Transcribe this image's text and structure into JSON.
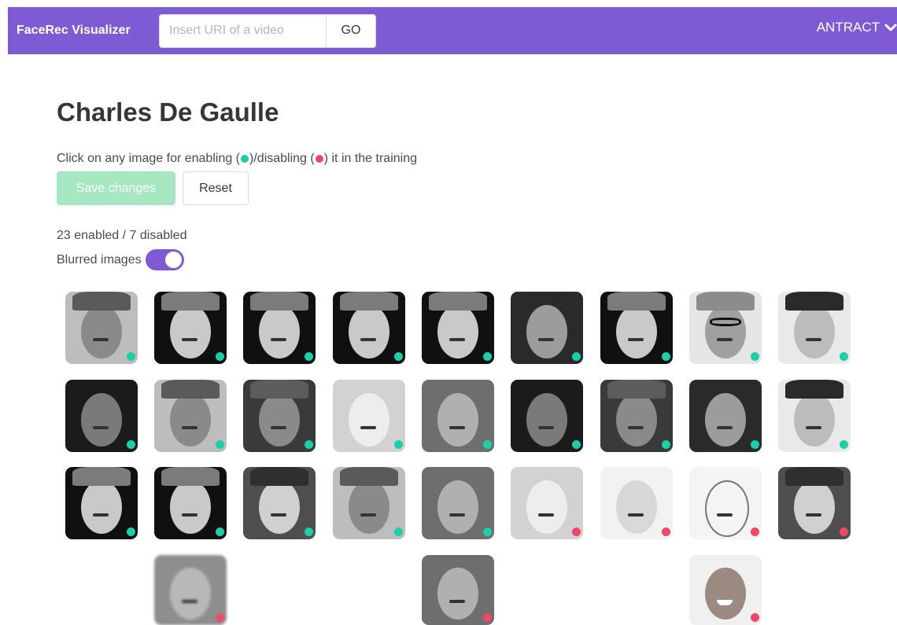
{
  "app": {
    "brand": "FaceRec Visualizer",
    "search_placeholder": "Insert URI of a video",
    "go_label": "GO",
    "user_label": "ANTRACT"
  },
  "page": {
    "title": "Charles De Gaulle",
    "instruction_pre": "Click on any image for enabling (",
    "instruction_mid": ")/disabling (",
    "instruction_post": ") it in the training",
    "save_label": "Save changes",
    "reset_label": "Reset",
    "counts_text": "23 enabled / 7 disabled",
    "blur_label": "Blurred images",
    "blur_enabled": true
  },
  "colors": {
    "accent": "#7e5bd4",
    "enabled": "#1ccfa4",
    "disabled": "#f14668",
    "save_button": "#a6e7c2"
  },
  "faces": [
    {
      "enabled": true,
      "tone": "gray-cap"
    },
    {
      "enabled": true,
      "tone": "dark-kepi"
    },
    {
      "enabled": true,
      "tone": "dark-kepi"
    },
    {
      "enabled": true,
      "tone": "dark-kepi"
    },
    {
      "enabled": true,
      "tone": "dark-kepi"
    },
    {
      "enabled": true,
      "tone": "older-dark"
    },
    {
      "enabled": true,
      "tone": "dark-kepi"
    },
    {
      "enabled": true,
      "tone": "glasses-cap"
    },
    {
      "enabled": true,
      "tone": "light-profile"
    },
    {
      "enabled": true,
      "tone": "dark"
    },
    {
      "enabled": true,
      "tone": "gray-cap"
    },
    {
      "enabled": true,
      "tone": "gray-kepi"
    },
    {
      "enabled": true,
      "tone": "light"
    },
    {
      "enabled": true,
      "tone": "gray"
    },
    {
      "enabled": true,
      "tone": "dark"
    },
    {
      "enabled": true,
      "tone": "gray-kepi"
    },
    {
      "enabled": true,
      "tone": "older-dark"
    },
    {
      "enabled": true,
      "tone": "light-profile"
    },
    {
      "enabled": true,
      "tone": "dark-kepi"
    },
    {
      "enabled": true,
      "tone": "dark-kepi"
    },
    {
      "enabled": true,
      "tone": "dark-cap"
    },
    {
      "enabled": true,
      "tone": "gray-cap"
    },
    {
      "enabled": true,
      "tone": "gray"
    },
    {
      "enabled": false,
      "tone": "light"
    },
    {
      "enabled": false,
      "tone": "pale"
    },
    {
      "enabled": false,
      "tone": "sketch"
    },
    {
      "enabled": false,
      "tone": "dark-cap"
    },
    {
      "enabled": false,
      "tone": "blurry"
    },
    {
      "enabled": false,
      "tone": "gray"
    },
    {
      "enabled": false,
      "tone": "smile"
    }
  ]
}
